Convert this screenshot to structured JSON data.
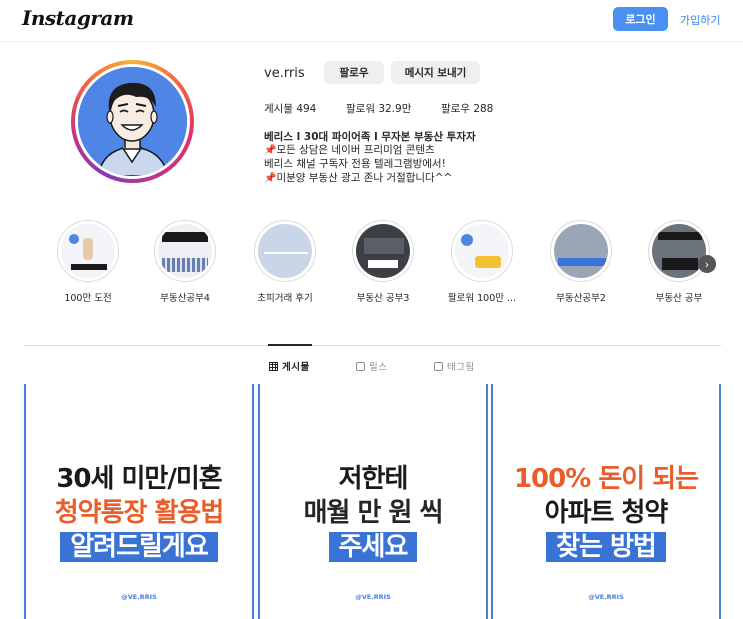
{
  "nav": {
    "logo": "Instagram",
    "login_label": "로그인",
    "signup_label": "가입하기"
  },
  "profile": {
    "username": "ve.rris",
    "follow_label": "팔로우",
    "message_label": "메시지 보내기",
    "stats": {
      "posts_label": "게시물 494",
      "followers_label": "팔로워 32.9만",
      "following_label": "팔로우 288"
    },
    "bio": {
      "name": "베리스 l 30대 파이어족 l 무자본 부동산 투자자",
      "line1": "모든 상담은 네이버 프리미엄 콘텐츠",
      "line2": "베리스 채널 구독자 전용 텔레그램방에서!",
      "line3": "미분양 부동산 광고 존나 거절합니다^^"
    }
  },
  "highlights": [
    {
      "label": "100만 도전"
    },
    {
      "label": "부동산공부4"
    },
    {
      "label": "초피거래 후기"
    },
    {
      "label": "부동산 공부3"
    },
    {
      "label": "팔로워 100만 ..."
    },
    {
      "label": "부동산공부2"
    },
    {
      "label": "부동산 공부"
    }
  ],
  "tabs": {
    "posts": "게시물",
    "reels": "릴스",
    "tagged": "태그됨"
  },
  "posts": [
    {
      "line1": "30세 미만/미혼",
      "line2": "청약통장 활용법",
      "line3": "알려드릴게요",
      "handle": "@VE.RRIS"
    },
    {
      "line1": "저한테",
      "line2a": "매월",
      "line2b": " 만 원 씩",
      "line3": "주세요",
      "handle": "@VE.RRIS"
    },
    {
      "line1": "100% 돈이 되는",
      "line2": "아파트 청약",
      "line3": "찾는 방법",
      "handle": "@VE.RRIS"
    }
  ],
  "colors": {
    "accent": "#4a90f0",
    "post_orange": "#e85d2a",
    "post_blue": "#3a73d6"
  }
}
